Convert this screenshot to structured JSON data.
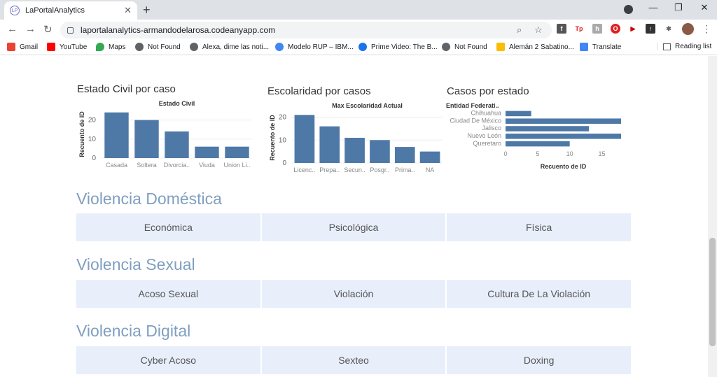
{
  "browser": {
    "tab_title": "LaPortalAnalytics",
    "tab_favicon": "LP",
    "url": "laportalanalytics-armandodelarosa.codeanyapp.com",
    "bookmarks": [
      "Gmail",
      "YouTube",
      "Maps",
      "Not Found",
      "Alexa, dime las noti...",
      "Modelo RUP – IBM...",
      "Prime Video: The B...",
      "Not Found",
      "Alemán 2 Sabatino...",
      "Translate"
    ],
    "reading_list": "Reading list",
    "extensions": [
      "f",
      "Tp",
      "h",
      "O",
      "▶",
      "↑",
      "✱"
    ]
  },
  "charts": {
    "estado_civil": {
      "title": "Estado Civil por caso",
      "subtitle": "Estado Civil",
      "ylabel": "Recuento de ID",
      "yticks": [
        "20",
        "10",
        "0"
      ],
      "labels": [
        "Casada",
        "Soltera",
        "Divorcia..",
        "Viuda",
        "Union Li.."
      ]
    },
    "escolaridad": {
      "title": "Escolaridad por casos",
      "subtitle": "Max Escolaridad Actual",
      "ylabel": "Recuento de ID",
      "yticks": [
        "20",
        "10",
        "0"
      ],
      "labels": [
        "Licenc..",
        "Prepa..",
        "Secun..",
        "Posgr..",
        "Prima..",
        "NA"
      ]
    },
    "casos_estado": {
      "title": "Casos por estado",
      "subtitle": "Entidad Federati..",
      "xlabel": "Recuento de ID",
      "xticks": [
        "0",
        "5",
        "10",
        "15"
      ],
      "labels": [
        "Chihuahua",
        "Ciudad De México",
        "Jalisco",
        "Nuevo León",
        "Queretaro"
      ]
    }
  },
  "chart_data": [
    {
      "type": "bar",
      "title": "Estado Civil por caso",
      "xlabel": "Estado Civil",
      "ylabel": "Recuento de ID",
      "categories": [
        "Casada",
        "Soltera",
        "Divorcia..",
        "Viuda",
        "Union Li.."
      ],
      "values": [
        24,
        20,
        14,
        6,
        6
      ],
      "ylim": [
        0,
        25
      ],
      "color": "#4e79a7"
    },
    {
      "type": "bar",
      "title": "Escolaridad por casos",
      "xlabel": "Max Escolaridad Actual",
      "ylabel": "Recuento de ID",
      "categories": [
        "Licenc..",
        "Prepa..",
        "Secun..",
        "Posgr..",
        "Prima..",
        "NA"
      ],
      "values": [
        21,
        16,
        11,
        10,
        7,
        5
      ],
      "ylim": [
        0,
        22
      ],
      "color": "#4e79a7"
    },
    {
      "type": "bar",
      "orientation": "horizontal",
      "title": "Casos por estado",
      "xlabel": "Recuento de ID",
      "ylabel": "Entidad Federati..",
      "categories": [
        "Chihuahua",
        "Ciudad De México",
        "Jalisco",
        "Nuevo León",
        "Queretaro"
      ],
      "values": [
        4,
        18,
        13,
        18,
        10
      ],
      "xlim": [
        0,
        18
      ],
      "color": "#4e79a7"
    }
  ],
  "sections": [
    {
      "title": "Violencia Doméstica",
      "items": [
        "Económica",
        "Psicológica",
        "Física"
      ]
    },
    {
      "title": "Violencia Sexual",
      "items": [
        "Acoso Sexual",
        "Violación",
        "Cultura De La Violación"
      ]
    },
    {
      "title": "Violencia Digital",
      "items": [
        "Cyber Acoso",
        "Sexteo",
        "Doxing"
      ]
    }
  ]
}
